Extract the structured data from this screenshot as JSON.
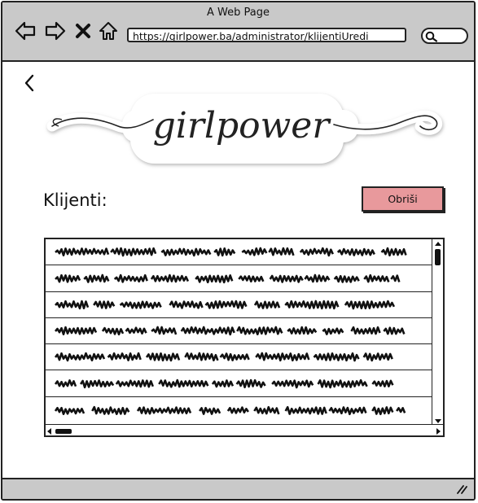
{
  "window": {
    "title": "A Web Page"
  },
  "browser": {
    "url": "https://girlpower.ba/administrator/klijentiUredi"
  },
  "logo": {
    "text": "girlpower"
  },
  "page": {
    "title": "Klijenti:",
    "delete_label": "Obriši"
  },
  "list": {
    "row_count": 7,
    "rows_content": "scribbled placeholder text"
  },
  "colors": {
    "delete_button": "#e8999c",
    "chrome": "#c9c9c9"
  }
}
